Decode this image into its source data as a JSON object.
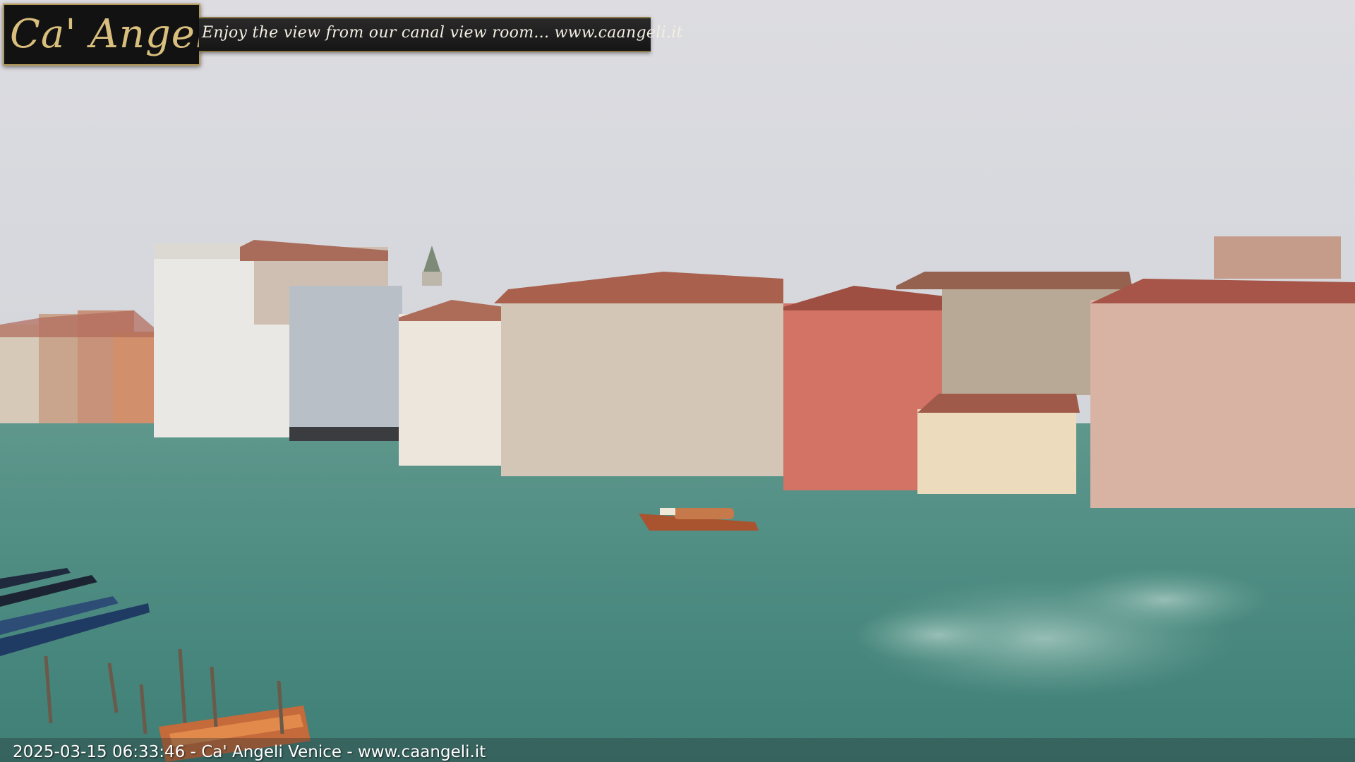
{
  "overlay": {
    "logo_text": "Ca' Angeli",
    "tagline": "Enjoy the view from our canal view room... www.caangeli.it",
    "timestamp": "2025-03-15 06:33:46",
    "separator": " - ",
    "footer_name": "Ca' Angeli Venice",
    "footer_url": "www.caangeli.it"
  },
  "colors": {
    "sky": "#d8d9dd",
    "water": "#5e9a8e",
    "logo_gold": "#d9bf7d",
    "banner_bg": "#121212"
  }
}
